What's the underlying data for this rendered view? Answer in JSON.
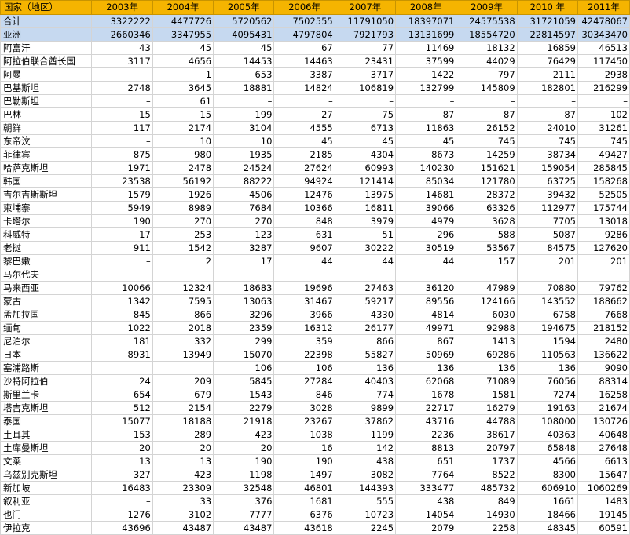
{
  "header": [
    "国家（地区）",
    "2003年",
    "2004年",
    "2005年",
    "2006年",
    "2007年",
    "2008年",
    "2009年",
    "2010 年",
    "2011年"
  ],
  "rows": [
    {
      "summary": true,
      "cells": [
        "合计",
        "3322222",
        "4477726",
        "5720562",
        "7502555",
        "11791050",
        "18397071",
        "24575538",
        "31721059",
        "42478067"
      ]
    },
    {
      "summary": true,
      "cells": [
        "亚洲",
        "2660346",
        "3347955",
        "4095431",
        "4797804",
        "7921793",
        "13131699",
        "18554720",
        "22814597",
        "30343470"
      ]
    },
    {
      "cells": [
        "阿富汗",
        "43",
        "45",
        "45",
        "67",
        "77",
        "11469",
        "18132",
        "16859",
        "46513"
      ]
    },
    {
      "cells": [
        "阿拉伯联合酋长国",
        "3117",
        "4656",
        "14453",
        "14463",
        "23431",
        "37599",
        "44029",
        "76429",
        "117450"
      ]
    },
    {
      "cells": [
        "阿曼",
        "–",
        "1",
        "653",
        "3387",
        "3717",
        "1422",
        "797",
        "2111",
        "2938"
      ]
    },
    {
      "cells": [
        "巴基斯坦",
        "2748",
        "3645",
        "18881",
        "14824",
        "106819",
        "132799",
        "145809",
        "182801",
        "216299"
      ]
    },
    {
      "cells": [
        "巴勒斯坦",
        "–",
        "61",
        "–",
        "–",
        "–",
        "–",
        "–",
        "–",
        "–"
      ]
    },
    {
      "cells": [
        "巴林",
        "15",
        "15",
        "199",
        "27",
        "75",
        "87",
        "87",
        "87",
        "102"
      ]
    },
    {
      "cells": [
        "朝鲜",
        "117",
        "2174",
        "3104",
        "4555",
        "6713",
        "11863",
        "26152",
        "24010",
        "31261"
      ]
    },
    {
      "cells": [
        "东帝汶",
        "–",
        "10",
        "10",
        "45",
        "45",
        "45",
        "745",
        "745",
        "745"
      ]
    },
    {
      "cells": [
        "菲律宾",
        "875",
        "980",
        "1935",
        "2185",
        "4304",
        "8673",
        "14259",
        "38734",
        "49427"
      ]
    },
    {
      "cells": [
        "哈萨克斯坦",
        "1971",
        "2478",
        "24524",
        "27624",
        "60993",
        "140230",
        "151621",
        "159054",
        "285845"
      ]
    },
    {
      "cells": [
        "韩国",
        "23538",
        "56192",
        "88222",
        "94924",
        "121414",
        "85034",
        "121780",
        "63725",
        "158268"
      ]
    },
    {
      "cells": [
        "吉尔吉斯斯坦",
        "1579",
        "1926",
        "4506",
        "12476",
        "13975",
        "14681",
        "28372",
        "39432",
        "52505"
      ]
    },
    {
      "cells": [
        "柬埔寨",
        "5949",
        "8989",
        "7684",
        "10366",
        "16811",
        "39066",
        "63326",
        "112977",
        "175744"
      ]
    },
    {
      "cells": [
        "卡塔尔",
        "190",
        "270",
        "270",
        "848",
        "3979",
        "4979",
        "3628",
        "7705",
        "13018"
      ]
    },
    {
      "cells": [
        "科威特",
        "17",
        "253",
        "123",
        "631",
        "51",
        "296",
        "588",
        "5087",
        "9286"
      ]
    },
    {
      "cells": [
        "老挝",
        "911",
        "1542",
        "3287",
        "9607",
        "30222",
        "30519",
        "53567",
        "84575",
        "127620"
      ]
    },
    {
      "cells": [
        "黎巴嫩",
        "–",
        "2",
        "17",
        "44",
        "44",
        "44",
        "157",
        "201",
        "201"
      ]
    },
    {
      "cells": [
        "马尔代夫",
        "",
        "",
        "",
        "",
        "",
        "",
        "",
        "",
        "–"
      ]
    },
    {
      "cells": [
        "马来西亚",
        "10066",
        "12324",
        "18683",
        "19696",
        "27463",
        "36120",
        "47989",
        "70880",
        "79762"
      ]
    },
    {
      "cells": [
        "蒙古",
        "1342",
        "7595",
        "13063",
        "31467",
        "59217",
        "89556",
        "124166",
        "143552",
        "188662"
      ]
    },
    {
      "cells": [
        "孟加拉国",
        "845",
        "866",
        "3296",
        "3966",
        "4330",
        "4814",
        "6030",
        "6758",
        "7668"
      ]
    },
    {
      "cells": [
        "缅甸",
        "1022",
        "2018",
        "2359",
        "16312",
        "26177",
        "49971",
        "92988",
        "194675",
        "218152"
      ]
    },
    {
      "cells": [
        "尼泊尔",
        "181",
        "332",
        "299",
        "359",
        "866",
        "867",
        "1413",
        "1594",
        "2480"
      ]
    },
    {
      "cells": [
        "日本",
        "8931",
        "13949",
        "15070",
        "22398",
        "55827",
        "50969",
        "69286",
        "110563",
        "136622"
      ]
    },
    {
      "cells": [
        "塞浦路斯",
        "",
        "",
        "106",
        "106",
        "136",
        "136",
        "136",
        "136",
        "9090"
      ]
    },
    {
      "cells": [
        "沙特阿拉伯",
        "24",
        "209",
        "5845",
        "27284",
        "40403",
        "62068",
        "71089",
        "76056",
        "88314"
      ]
    },
    {
      "cells": [
        "斯里兰卡",
        "654",
        "679",
        "1543",
        "846",
        "774",
        "1678",
        "1581",
        "7274",
        "16258"
      ]
    },
    {
      "cells": [
        "塔吉克斯坦",
        "512",
        "2154",
        "2279",
        "3028",
        "9899",
        "22717",
        "16279",
        "19163",
        "21674"
      ]
    },
    {
      "cells": [
        "泰国",
        "15077",
        "18188",
        "21918",
        "23267",
        "37862",
        "43716",
        "44788",
        "108000",
        "130726"
      ]
    },
    {
      "cells": [
        "土耳其",
        "153",
        "289",
        "423",
        "1038",
        "1199",
        "2236",
        "38617",
        "40363",
        "40648"
      ]
    },
    {
      "cells": [
        "土库曼斯坦",
        "20",
        "20",
        "20",
        "16",
        "142",
        "8813",
        "20797",
        "65848",
        "27648"
      ]
    },
    {
      "cells": [
        "文莱",
        "13",
        "13",
        "190",
        "190",
        "438",
        "651",
        "1737",
        "4566",
        "6613"
      ]
    },
    {
      "cells": [
        "乌兹别克斯坦",
        "327",
        "423",
        "1198",
        "1497",
        "3082",
        "7764",
        "8522",
        "8300",
        "15647"
      ]
    },
    {
      "cells": [
        "新加坡",
        "16483",
        "23309",
        "32548",
        "46801",
        "144393",
        "333477",
        "485732",
        "606910",
        "1060269"
      ]
    },
    {
      "cells": [
        "叙利亚",
        "–",
        "33",
        "376",
        "1681",
        "555",
        "438",
        "849",
        "1661",
        "1483"
      ]
    },
    {
      "cells": [
        "也门",
        "1276",
        "3102",
        "7777",
        "6376",
        "10723",
        "14054",
        "14930",
        "18466",
        "19145"
      ]
    },
    {
      "cells": [
        "伊拉克",
        "43696",
        "43487",
        "43487",
        "43618",
        "2245",
        "2079",
        "2258",
        "48345",
        "60591"
      ]
    }
  ]
}
